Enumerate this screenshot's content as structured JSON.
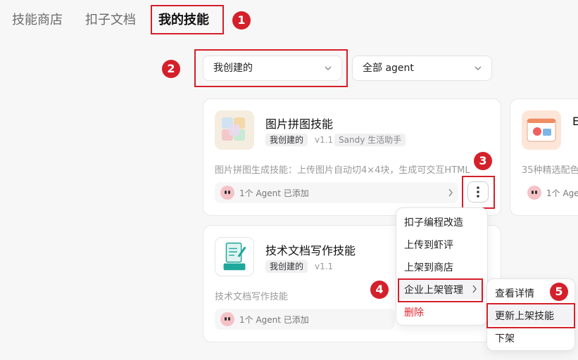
{
  "tabs": [
    "技能商店",
    "扣子文档",
    "我的技能"
  ],
  "filters": {
    "creator": "我创建的",
    "agent": "全部 agent"
  },
  "markers": [
    "1",
    "2",
    "3",
    "4",
    "5"
  ],
  "cards": [
    {
      "title": "图片拼图技能",
      "badge": "我创建的",
      "version": "v1.1",
      "tag": "Sandy 生活助手",
      "desc": "图片拼图生成技能：上传图片自动切4×4块，生成可交互HTML",
      "footer": "1个 Agent 已添加"
    },
    {
      "title": "技术文档写作技能",
      "badge": "我创建的",
      "version": "v1.1",
      "desc": "技术文档写作技能",
      "footer": "1个 Agent 已添加"
    },
    {
      "title": "E",
      "desc": "35种精选配色",
      "footer": "1个 Agent"
    }
  ],
  "context_menu": [
    "扣子编程改造",
    "上传到虾评",
    "上架到商店",
    "企业上架管理",
    "删除"
  ],
  "submenu": [
    "查看详情",
    "更新上架技能",
    "下架"
  ],
  "colors": {
    "accent_red": "#d4202a",
    "delete_red": "#e0242d"
  }
}
